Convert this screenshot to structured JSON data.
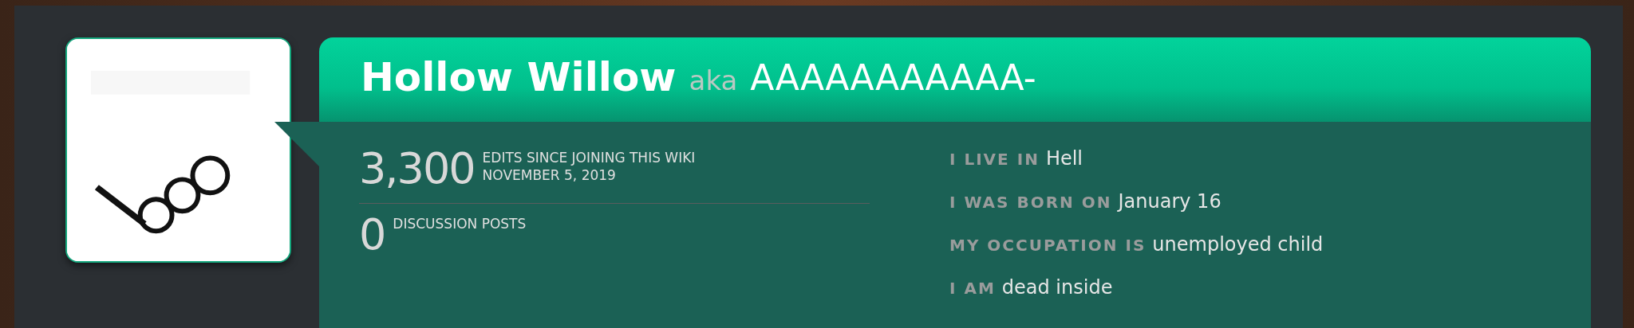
{
  "profile": {
    "name": "Hollow Willow",
    "aka": "aka",
    "alias": "AAAAAAAAAAA-"
  },
  "stats": [
    {
      "number": "3,300",
      "lines": [
        "EDITS SINCE JOINING THIS WIKI",
        "NOVEMBER 5, 2019"
      ]
    },
    {
      "number": "0",
      "lines": [
        "DISCUSSION POSTS"
      ]
    }
  ],
  "details": [
    {
      "label": "I LIVE IN",
      "value": "Hell"
    },
    {
      "label": "I WAS BORN ON",
      "value": "January 16"
    },
    {
      "label": "MY OCCUPATION IS",
      "value": "unemployed child"
    },
    {
      "label": "I AM",
      "value": "dead inside"
    }
  ]
}
